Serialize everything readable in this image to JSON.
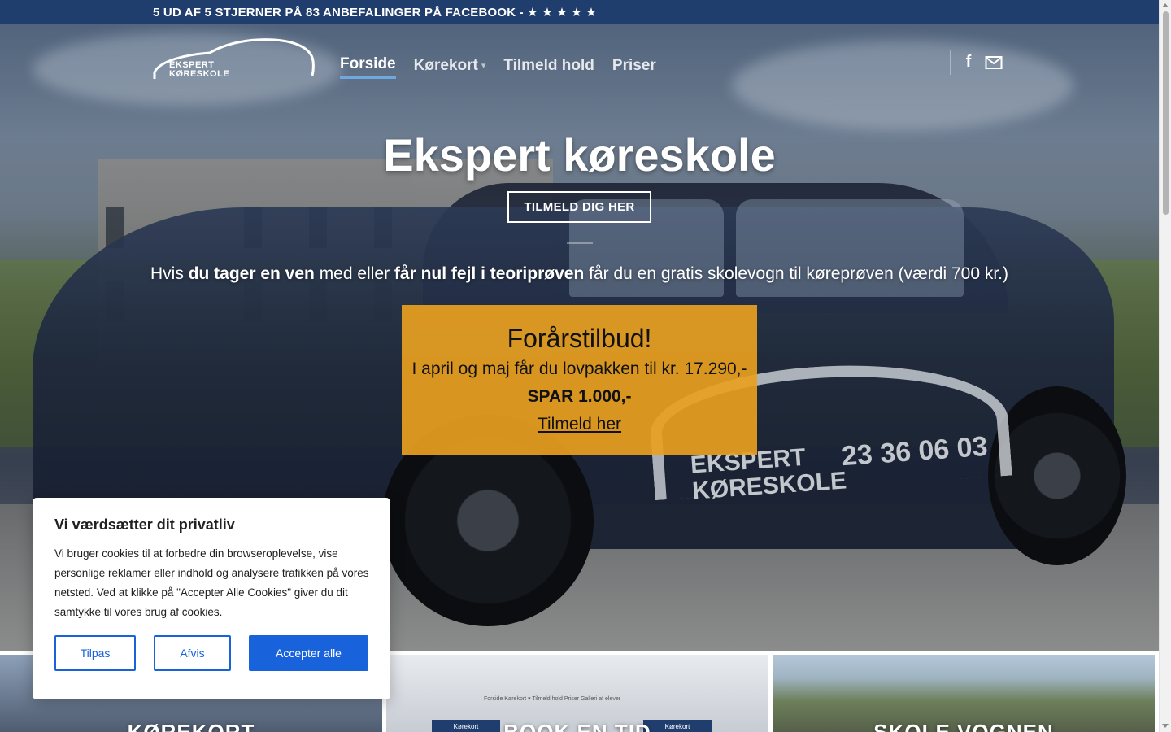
{
  "topbar": {
    "text": "5 UD AF 5 STJERNER PÅ 83 ANBEFALINGER PÅ FACEBOOK - ★ ★ ★ ★ ★"
  },
  "logo": {
    "line1": "EKSPERT",
    "line2": "KØRESKOLE"
  },
  "nav": {
    "items": [
      {
        "label": "Forside",
        "active": true
      },
      {
        "label": "Kørekort",
        "has_dropdown": true
      },
      {
        "label": "Tilmeld hold"
      },
      {
        "label": "Priser"
      }
    ]
  },
  "social": {
    "facebook_icon": "facebook-icon",
    "email_icon": "envelope-icon"
  },
  "hero": {
    "title": "Ekspert køreskole",
    "button": "TILMELD DIG HER",
    "sub_prefix": "Hvis ",
    "sub_bold1": "du tager en ven",
    "sub_mid": " med eller ",
    "sub_bold2": "får nul fejl i teoriprøven",
    "sub_suffix": " får du en gratis skolevogn til køreprøven (værdi 700 kr.)"
  },
  "car": {
    "brand_line1": "EKSPERT",
    "brand_line2": "KØRESKOLE",
    "phone": "23 36 06 03"
  },
  "offer": {
    "title": "Forårstilbud!",
    "line": "I april og maj får du lovpakken til kr. 17.290,-",
    "bold": "SPAR 1.000,-",
    "link": "Tilmeld her"
  },
  "cards": [
    {
      "title": "KØREKORT"
    },
    {
      "title": "BOOK EN TID",
      "mini_nav": "Forside   Kørekort ▾   Tilmeld hold   Priser   Galleri af elever",
      "mini_btn1": "Kørekort",
      "mini_btn2": "Kørekort"
    },
    {
      "title": "SKOLE VOGNEN"
    }
  ],
  "cookie": {
    "title": "Vi værdsætter dit privatliv",
    "text": "Vi bruger cookies til at forbedre din browseroplevelse, vise personlige reklamer eller indhold og analysere trafikken på vores netsted. Ved at klikke på \"Accepter Alle Cookies\" giver du dit samtykke til vores brug af cookies.",
    "btn_customize": "Tilpas",
    "btn_reject": "Afvis",
    "btn_accept": "Accepter alle"
  },
  "colors": {
    "topbar": "#1f3e6e",
    "offer": "#e8a020",
    "cookie_accent": "#1863dc"
  }
}
